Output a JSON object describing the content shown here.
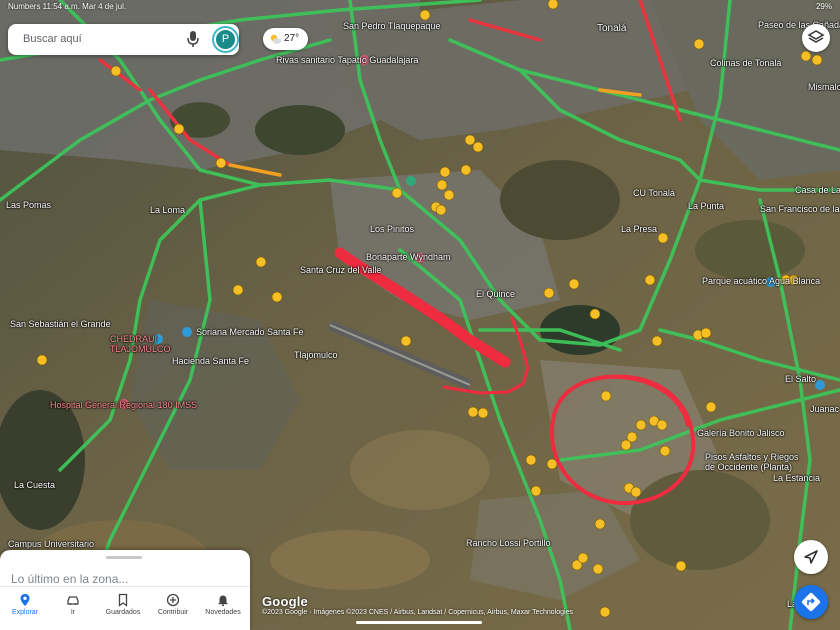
{
  "status_bar": {
    "left": "Numbers 11:54 a.m.  Mar 4 de jul.",
    "right": "29%"
  },
  "search": {
    "placeholder": "Buscar aquí",
    "avatar_letter": "P"
  },
  "weather": {
    "temperature": "27°",
    "icon": "partly-cloudy-icon"
  },
  "map": {
    "place_labels": [
      "San Pedro Tlaquepaque",
      "Tonalá",
      "Paseo de las Cañadas",
      "Colinas de Tonalá",
      "Mismalo",
      "Rivas sanitario Tapatío Guadalajara",
      "Las Pomas",
      "La Loma",
      "Los Pinitos",
      "Bonaparte Wyndham",
      "El Quince",
      "Santa Cruz del Valle",
      "CU Tonalá",
      "La Punta",
      "San Francisco de la Soledad",
      "Casa de La",
      "La Presa",
      "Parque acuático Agua Blanca",
      "San Sebastián el Grande",
      "Soriana Mercado Santa Fe",
      "Hacienda Santa Fe",
      "Tlajomulco",
      "Hospital General Regional 180 IMSS",
      "El Salto",
      "Juanac",
      "Galería Bonito Jalisco",
      "Pisos Asfaltos y Riegos de Occidente (Planta)",
      "La Estancia",
      "La Cuesta",
      "Campus Universitario",
      "Rancho Lossi Portillo",
      "La Capilla"
    ],
    "red_labels": [
      "CHEDRAUI TLAJOMULCO"
    ],
    "annotation": {
      "type": "hand-drawn arrow and circle",
      "color": "#ee2b3f"
    }
  },
  "controls": {
    "layers": "layers-icon",
    "compass": "navigation-arrow-icon",
    "directions": "directions-icon"
  },
  "bottom_sheet": {
    "title": "Lo último en la zona...",
    "tabs": [
      {
        "label": "Explorar",
        "icon": "location-pin-icon",
        "active": true
      },
      {
        "label": "Ir",
        "icon": "car-icon",
        "active": false
      },
      {
        "label": "Guardados",
        "icon": "bookmark-icon",
        "active": false
      },
      {
        "label": "Contribuir",
        "icon": "add-circle-icon",
        "active": false
      },
      {
        "label": "Novedades",
        "icon": "bell-icon",
        "active": false
      }
    ]
  },
  "attribution": {
    "logo": "Google",
    "credits": "©2023 Google · Imágenes ©2023 CNES / Airbus, Landsat / Copernicus, Airbus, Maxar Technologies"
  },
  "colors": {
    "traffic_green": "#3ec45a",
    "traffic_red": "#e8343f",
    "traffic_orange": "#f1a021",
    "pin_yellow": "#f6bf26",
    "accent_blue": "#1a73e8"
  }
}
